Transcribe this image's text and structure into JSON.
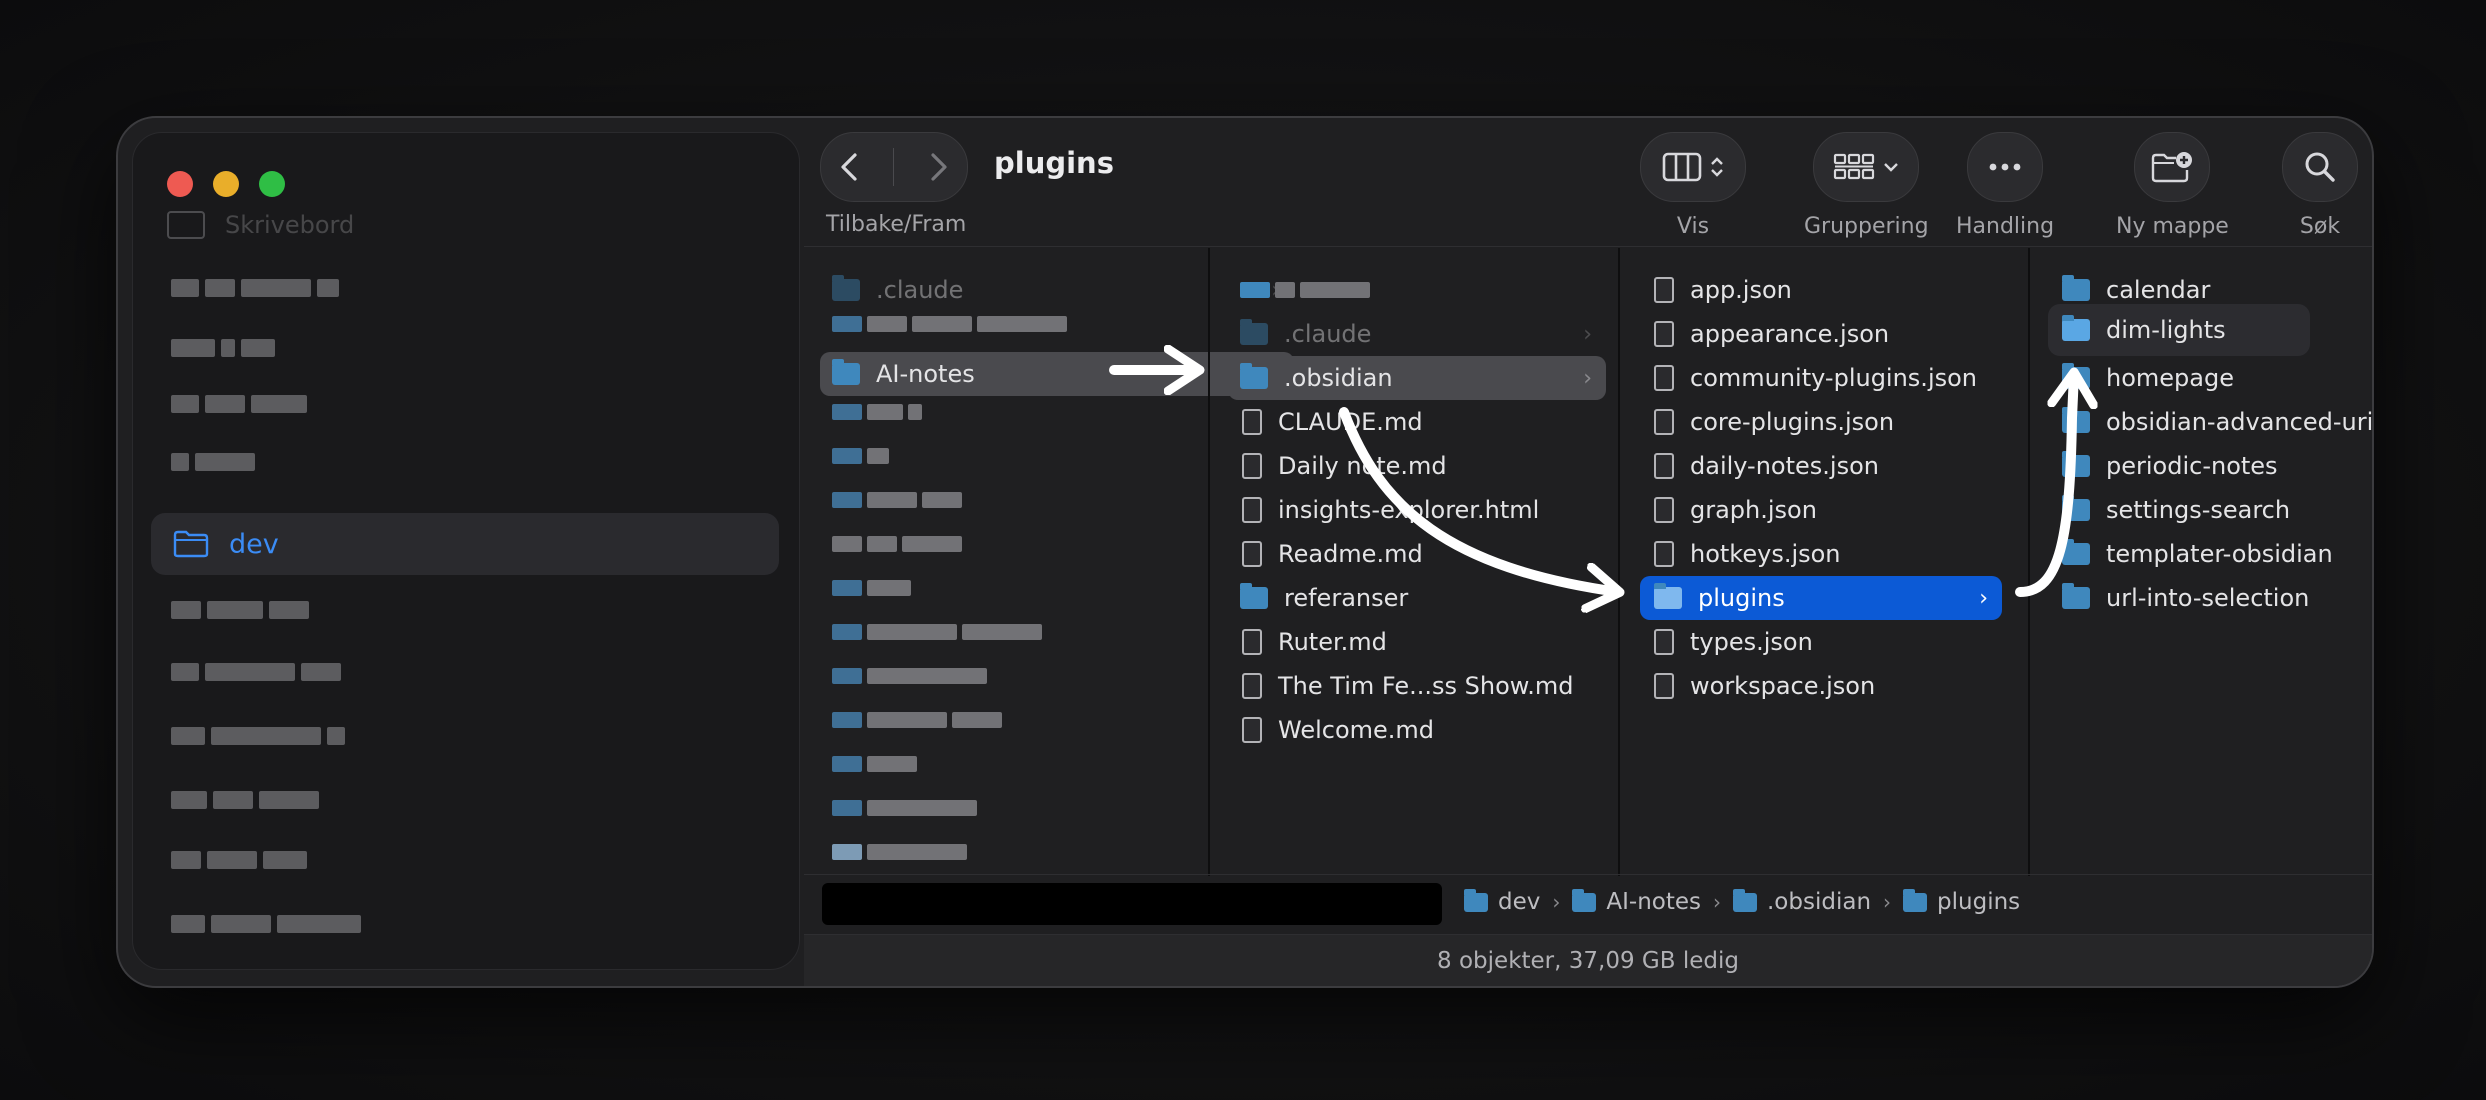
{
  "window": {
    "title": "plugins"
  },
  "sidebar": {
    "top_item": "Skrivebord",
    "selected_item": "dev"
  },
  "toolbar": {
    "nav_caption": "Tilbake/Fram",
    "view_label": "Vis",
    "group_label": "Gruppering",
    "action_label": "Handling",
    "newfolder_label": "Ny mappe",
    "search_label": "Søk"
  },
  "column1": {
    "items": [
      {
        "label": ".claude",
        "type": "folder",
        "dim": true
      },
      {
        "label": "AI-notes",
        "type": "folder",
        "selected": true
      }
    ]
  },
  "column2": {
    "items": [
      {
        "label": ".claude",
        "type": "folder",
        "dim": true
      },
      {
        "label": ".obsidian",
        "type": "folder",
        "selected": true
      },
      {
        "label": "CLAUDE.md",
        "type": "file"
      },
      {
        "label": "Daily note.md",
        "type": "file"
      },
      {
        "label": "insights-explorer.html",
        "type": "file"
      },
      {
        "label": "Readme.md",
        "type": "file"
      },
      {
        "label": "referanser",
        "type": "folder"
      },
      {
        "label": "Ruter.md",
        "type": "file"
      },
      {
        "label": "The Tim Fe...ss Show.md",
        "type": "file"
      },
      {
        "label": "Welcome.md",
        "type": "file"
      }
    ]
  },
  "column3": {
    "items": [
      {
        "label": "app.json",
        "type": "file"
      },
      {
        "label": "appearance.json",
        "type": "file"
      },
      {
        "label": "community-plugins.json",
        "type": "file"
      },
      {
        "label": "core-plugins.json",
        "type": "file"
      },
      {
        "label": "daily-notes.json",
        "type": "file"
      },
      {
        "label": "graph.json",
        "type": "file"
      },
      {
        "label": "hotkeys.json",
        "type": "file"
      },
      {
        "label": "plugins",
        "type": "folder",
        "selected": true
      },
      {
        "label": "types.json",
        "type": "file"
      },
      {
        "label": "workspace.json",
        "type": "file"
      }
    ]
  },
  "column4": {
    "items": [
      {
        "label": "calendar",
        "type": "folder"
      },
      {
        "label": "dim-lights",
        "type": "folder",
        "selected": true
      },
      {
        "label": "homepage",
        "type": "folder"
      },
      {
        "label": "obsidian-advanced-uri",
        "type": "folder"
      },
      {
        "label": "periodic-notes",
        "type": "folder"
      },
      {
        "label": "settings-search",
        "type": "folder"
      },
      {
        "label": "templater-obsidian",
        "type": "folder"
      },
      {
        "label": "url-into-selection",
        "type": "folder"
      }
    ]
  },
  "pathbar": {
    "crumbs": [
      "dev",
      "AI-notes",
      ".obsidian",
      "plugins"
    ]
  },
  "status": {
    "text": "8 objekter, 37,09 GB ledig"
  },
  "colors": {
    "accent": "#0c5ad6",
    "folder": "#3f88bd",
    "sidebar_accent": "#3b8cf5"
  }
}
